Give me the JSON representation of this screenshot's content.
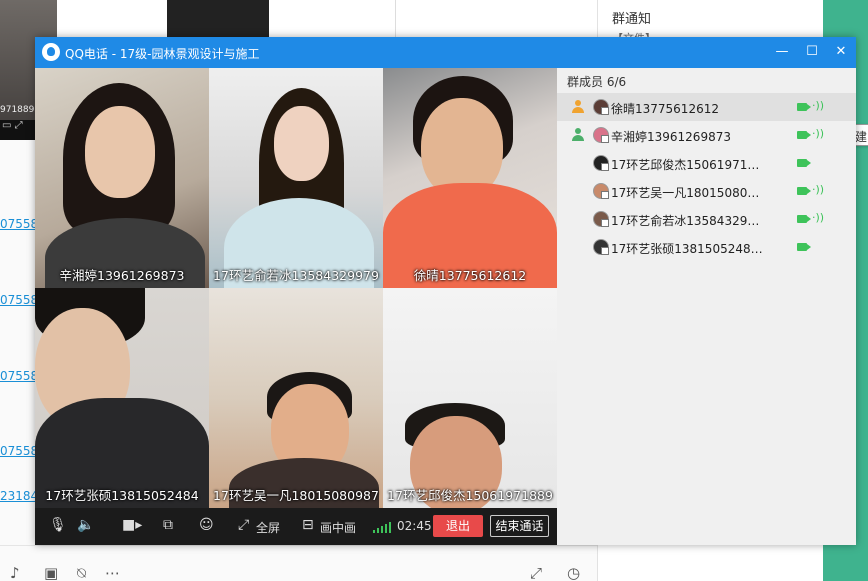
{
  "background": {
    "thumb_text": "971889",
    "links": [
      "07558",
      "07558",
      "07558",
      "07558",
      "23184"
    ],
    "close_glyph": "×",
    "notice_title": "群通知",
    "notice_sub": "【文件】…",
    "tooltip": "创建"
  },
  "window": {
    "title": "QQ电话 - 17级-园林景观设计与施工",
    "min": "—",
    "max": "☐",
    "close": "✕"
  },
  "tiles": [
    {
      "caption": "辛湘婷13961269873"
    },
    {
      "caption": "17环艺俞若冰13584329979"
    },
    {
      "caption": "徐晴13775612612"
    },
    {
      "caption": "17环艺张硕13815052484"
    },
    {
      "caption": "17环艺吴一凡18015080987"
    },
    {
      "caption": "17环艺邱俊杰15061971889"
    }
  ],
  "toolbar": {
    "mic_icon": "mic-icon",
    "speaker_icon": "speaker-icon",
    "camera_icon": "camera-icon",
    "share_icon": "share-screen-icon",
    "fullscreen_label": "全屏",
    "pip_label": "画中画",
    "timer": "02:45",
    "exit_label": "退出",
    "end_label": "结束通话"
  },
  "panel": {
    "title": "群成员 6/6",
    "members": [
      {
        "name": "徐晴13775612612",
        "host": true,
        "speaking": true
      },
      {
        "name": "辛湘婷13961269873",
        "host": true,
        "speaking": true
      },
      {
        "name": "17环艺邱俊杰15061971…",
        "host": false,
        "speaking": false
      },
      {
        "name": "17环艺吴一凡18015080…",
        "host": false,
        "speaking": true
      },
      {
        "name": "17环艺俞若冰13584329…",
        "host": false,
        "speaking": true
      },
      {
        "name": "17环艺张硕1381505248…",
        "host": false,
        "speaking": false
      }
    ]
  },
  "colors": {
    "titlebar": "#1f8ae6",
    "exit": "#e84a4a",
    "active_green": "#3ec35a",
    "side_green": "#3fb38e"
  }
}
